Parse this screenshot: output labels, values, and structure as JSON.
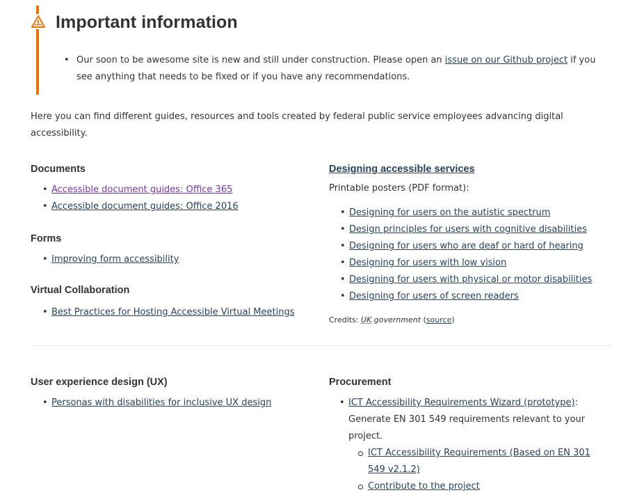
{
  "alert": {
    "title": "Important information",
    "text_before": "Our soon to be awesome site is new and still under construction. Please open an ",
    "link": "issue on our Github project",
    "text_after": " if you see anything that needs to be fixed or if you have any recommendations.",
    "accent_color": "#ee7100",
    "icon": "warning-icon"
  },
  "intro": "Here you can find different guides, resources and tools created by federal public service employees advancing digital accessibility.",
  "documents": {
    "title": "Documents",
    "links": [
      "Accessible document guides: Office 365",
      "Accessible document guides: Office 2016"
    ]
  },
  "forms": {
    "title": "Forms",
    "links": [
      "Improving form accessibility"
    ]
  },
  "virtual_collab": {
    "title": "Virtual Collaboration",
    "links": [
      "Best Practices for Hosting Accessible Virtual Meetings"
    ]
  },
  "designing": {
    "title": "Designing accessible services",
    "note": "Printable posters (PDF format):",
    "links": [
      "Designing for users on the autistic spectrum",
      "Design principles for users with cognitive disabilities",
      "Designing for users who are deaf or hard of hearing",
      "Designing for users with low vision",
      "Designing for users with physical or motor disabilities",
      "Designing for users of screen readers"
    ],
    "credits_label": "Credits: ",
    "credits_uk": "UK",
    "credits_gov": " government",
    "credits_open": " (",
    "credits_source": "source",
    "credits_close": ")"
  },
  "ux": {
    "title": "User experience design (UX)",
    "links": [
      "Personas with disabilities for inclusive UX design"
    ]
  },
  "procurement": {
    "title": "Procurement",
    "wizard_link": "ICT Accessibility Requirements Wizard (prototype)",
    "wizard_text": ": Generate EN 301 549 requirements relevant to your project.",
    "sub_links": [
      "ICT Accessibility Requirements (Based on EN 301 549 v2.1.2)",
      "Contribute to the project"
    ]
  },
  "colors": {
    "link": "#284162",
    "visited": "#7834bc",
    "text": "#333333"
  }
}
